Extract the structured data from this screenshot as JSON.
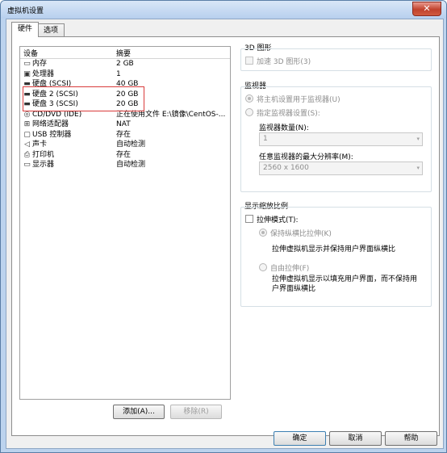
{
  "window": {
    "title": "虚拟机设置",
    "close_glyph": "✕"
  },
  "tabs": [
    {
      "label": "硬件"
    },
    {
      "label": "选项"
    }
  ],
  "device_list": {
    "columns": [
      "设备",
      "摘要"
    ],
    "rows": [
      {
        "icon": "memory-icon",
        "glyph": "▭",
        "name": "内存",
        "summary": "2 GB"
      },
      {
        "icon": "processor-icon",
        "glyph": "▣",
        "name": "处理器",
        "summary": "1"
      },
      {
        "icon": "hard-disk-icon",
        "glyph": "▬",
        "name": "硬盘 (SCSI)",
        "summary": "40 GB"
      },
      {
        "icon": "hard-disk-icon",
        "glyph": "▬",
        "name": "硬盘 2 (SCSI)",
        "summary": "20 GB"
      },
      {
        "icon": "hard-disk-icon",
        "glyph": "▬",
        "name": "硬盘 3 (SCSI)",
        "summary": "20 GB"
      },
      {
        "icon": "cd-dvd-icon",
        "glyph": "◎",
        "name": "CD/DVD (IDE)",
        "summary": "正在使用文件 E:\\镜像\\CentOS-..."
      },
      {
        "icon": "network-adapter-icon",
        "glyph": "⊞",
        "name": "网络适配器",
        "summary": "NAT"
      },
      {
        "icon": "usb-icon",
        "glyph": "▢",
        "name": "USB 控制器",
        "summary": "存在"
      },
      {
        "icon": "sound-card-icon",
        "glyph": "◁",
        "name": "声卡",
        "summary": "自动检测"
      },
      {
        "icon": "printer-icon",
        "glyph": "⎙",
        "name": "打印机",
        "summary": "存在"
      },
      {
        "icon": "display-icon",
        "glyph": "▭",
        "name": "显示器",
        "summary": "自动检测"
      }
    ]
  },
  "buttons": {
    "add": "添加(A)...",
    "remove": "移除(R)",
    "ok": "确定",
    "cancel": "取消",
    "help": "帮助"
  },
  "graphics_3d": {
    "title": "3D 图形",
    "accelerate_label": "加速 3D 图形(3)"
  },
  "monitor": {
    "title": "监视器",
    "use_host_label": "将主机设置用于监视器(U)",
    "specify_label": "指定监视器设置(S):",
    "count_label": "监视器数量(N):",
    "count_value": "1",
    "max_res_label": "任意监视器的最大分辨率(M):",
    "max_res_value": "2560 x 1600",
    "arrow": "▾"
  },
  "scaling": {
    "title": "显示缩放比例",
    "stretch_label": "拉伸模式(T):",
    "keep_aspect_label": "保持纵横比拉伸(K)",
    "keep_aspect_desc": "拉伸虚拟机显示并保持用户界面纵横比",
    "free_label": "自由拉伸(F)",
    "free_desc_1": "拉伸虚拟机显示以填充用户界面，而不保持用",
    "free_desc_2": "户界面纵横比"
  }
}
